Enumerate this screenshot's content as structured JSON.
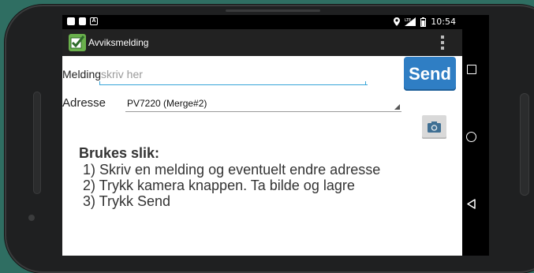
{
  "status_bar": {
    "time": "10:54",
    "notification_icons": [
      "notification-square-icon",
      "sd-card-icon",
      "a-notification-icon"
    ],
    "system_icons": [
      "location-icon",
      "lte-signal-icon",
      "battery-icon"
    ],
    "a_icon_text": "A"
  },
  "action_bar": {
    "app_title": "Avviksmelding",
    "app_icon": "checkmark-app-icon",
    "overflow_icon": "overflow-menu-icon"
  },
  "form": {
    "melding_label": "Melding",
    "melding_placeholder": "skriv her",
    "melding_value": "",
    "send_label": "Send",
    "adresse_label": "Adresse",
    "adresse_selected": "PV7220 (Merge#2)",
    "camera_icon": "camera-icon"
  },
  "instructions": {
    "title": "Brukes slik:",
    "steps": [
      "1) Skriv en melding og eventuelt endre adresse",
      "2) Trykk kamera knappen. Ta bilde og lagre",
      "3) Trykk Send"
    ]
  },
  "nav_bar": {
    "buttons": [
      "recents-icon",
      "home-icon",
      "back-icon"
    ]
  },
  "colors": {
    "accent": "#36a5d8",
    "send_button": "#2f7ec4",
    "action_bar": "#222222",
    "status_bar": "#000000",
    "wallpaper": "#2f6e62",
    "app_icon": "#6ab04c"
  }
}
